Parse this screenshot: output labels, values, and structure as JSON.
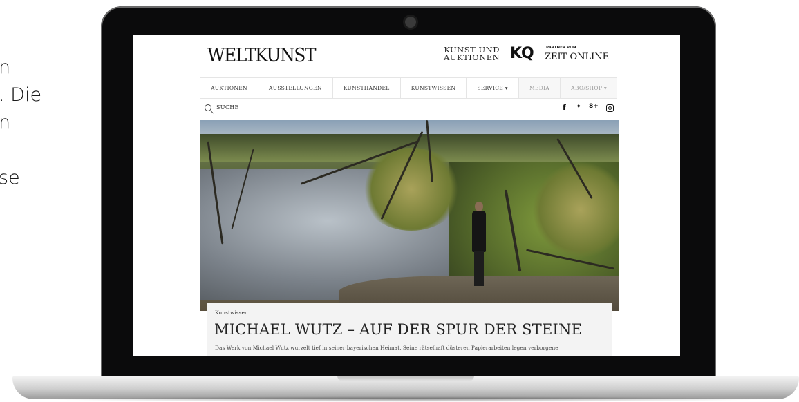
{
  "side_text": {
    "lines": [
      "n",
      ". Die",
      "n",
      "",
      "se"
    ]
  },
  "site": {
    "logo": "WELTKUNST",
    "partner_brand_line1": "KUNST UND",
    "partner_brand_line2": "AUKTIONEN",
    "kq_logo": "KQ",
    "partner_label": "PARTNER VON",
    "partner_name": "ZEIT ONLINE",
    "nav": [
      {
        "label": "AUKTIONEN"
      },
      {
        "label": "AUSSTELLUNGEN"
      },
      {
        "label": "KUNSTHANDEL"
      },
      {
        "label": "KUNSTWISSEN"
      },
      {
        "label": "SERVICE ▾"
      },
      {
        "label": "MEDIA"
      },
      {
        "label": "ABO/SHOP ▾"
      }
    ],
    "search_label": "SUCHE",
    "social": {
      "facebook": "f",
      "twitter": "🐦",
      "google_plus": "8+"
    },
    "article": {
      "category": "Kunstwissen",
      "headline": "MICHAEL WUTZ – AUF DER SPUR DER STEINE",
      "teaser": "Das Werk von Michael Wutz wurzelt tief in seiner bayerischen Heimat. Seine rätselhaft düsteren Papierarbeiten legen verborgene"
    }
  },
  "colors": {
    "bezel": "#0b0b0c",
    "page_bg": "#ffffff",
    "card_bg": "#f3f3f3"
  }
}
